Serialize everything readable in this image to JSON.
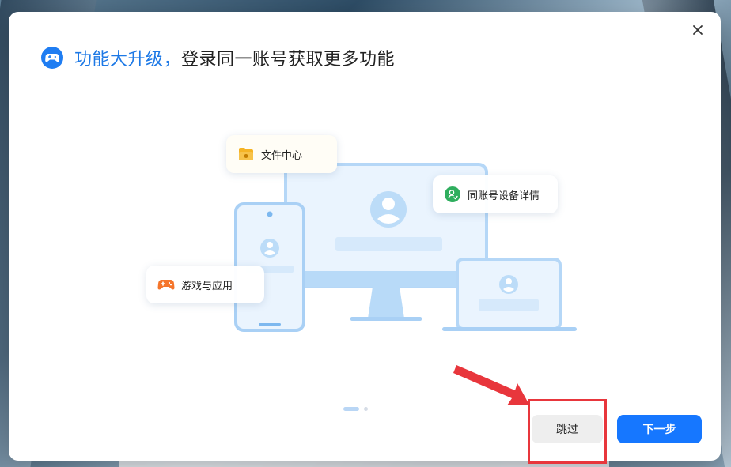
{
  "dialog": {
    "title_highlight": "功能大升级，",
    "title_rest": "登录同一账号获取更多功能"
  },
  "cards": {
    "files": "文件中心",
    "devices": "同账号设备详情",
    "games": "游戏与应用"
  },
  "pagination": {
    "current": 1,
    "total": 2
  },
  "buttons": {
    "skip": "跳过",
    "next": "下一步"
  },
  "colors": {
    "accent": "#1677ff",
    "title_highlight": "#1d79e6",
    "annotation": "#e8363c",
    "device_light": "#e9f3fd",
    "device_stroke": "#a9d0f5"
  },
  "icons": {
    "close": "close-icon",
    "logo": "gamepad-logo-icon",
    "files": "folder-icon",
    "devices": "account-link-icon",
    "games": "gamepad-icon"
  }
}
